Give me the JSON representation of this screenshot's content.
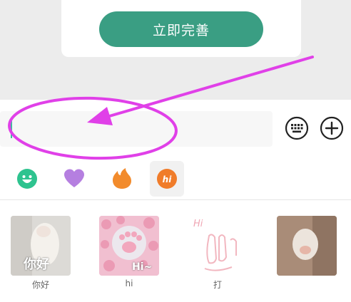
{
  "profile_prompt": {
    "complete_button_label": "立即完善"
  },
  "composer": {
    "input_value": "",
    "keyboard_icon": "keyboard-icon",
    "add_icon": "plus-circle-icon"
  },
  "emoji_tabs": [
    {
      "icon": "smiley-icon",
      "color": "#2ec38f"
    },
    {
      "icon": "heart-icon",
      "color": "#b57fe0"
    },
    {
      "icon": "flame-icon",
      "color": "#f28b2c"
    },
    {
      "icon": "hi-bubble-icon",
      "color": "#f07c2a",
      "text": "hi"
    }
  ],
  "stickers": [
    {
      "label": "你好",
      "overlay": "你好"
    },
    {
      "label": "hi",
      "overlay": "Hi~"
    },
    {
      "label": "打",
      "overlay": "Hi"
    },
    {
      "label": "",
      "overlay": ""
    }
  ],
  "colors": {
    "accent": "#3a9e83",
    "caret": "#35c29b",
    "annotation": "#e040e8"
  }
}
